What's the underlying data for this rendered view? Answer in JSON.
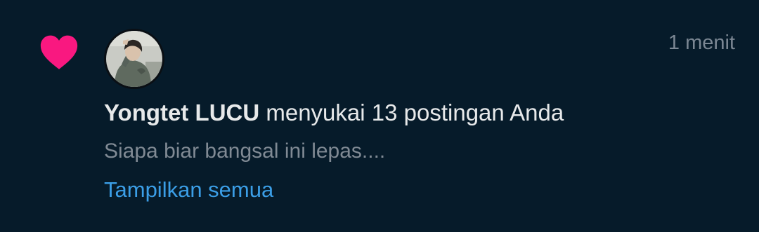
{
  "notification": {
    "type_icon": "heart-icon",
    "time": "1 menit",
    "username": "Yongtet LUCU",
    "action_text": "menyukai 13 postingan Anda",
    "preview": "Siapa biar bangsal ini lepas....",
    "show_all_label": "Tampilkan semua"
  },
  "colors": {
    "background": "#061b2a",
    "heart": "#f91880",
    "link": "#3b9ee6",
    "primary_text": "#e7e9ea",
    "secondary_text": "#808a94"
  }
}
